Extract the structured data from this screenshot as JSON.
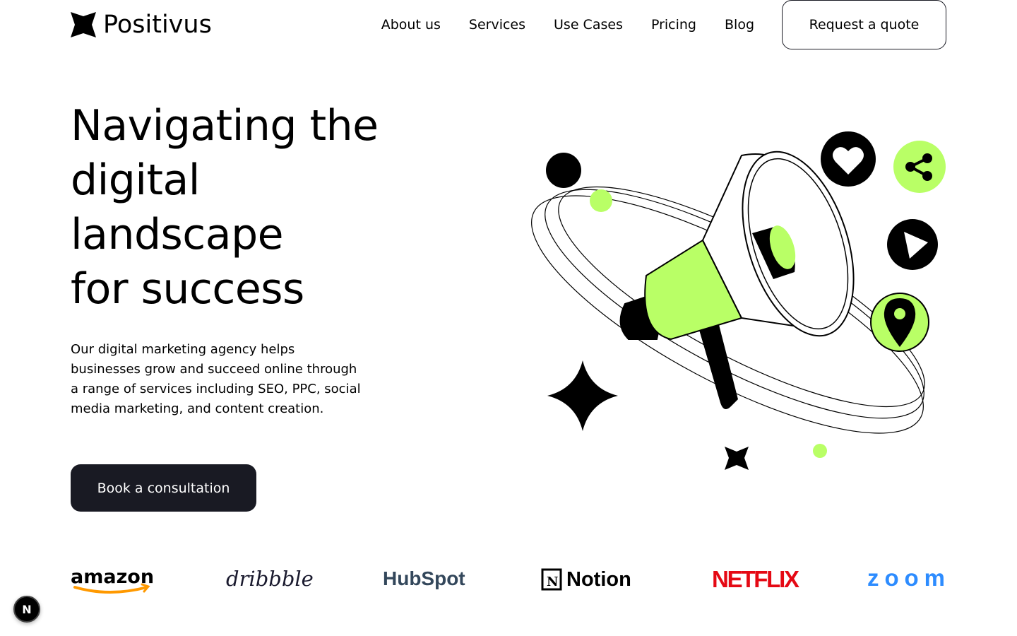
{
  "header": {
    "brand": "Positivus",
    "nav": [
      "About us",
      "Services",
      "Use Cases",
      "Pricing",
      "Blog"
    ],
    "cta": "Request a quote"
  },
  "hero": {
    "title_lines": [
      "Navigating the",
      "digital",
      "landscape",
      "for success"
    ],
    "description": "Our digital marketing agency helps businesses grow and succeed online through a range of services including SEO, PPC, social media marketing, and content creation.",
    "cta": "Book a consultation"
  },
  "logos": [
    "amazon",
    "dribbble",
    "HubSpot",
    "Notion",
    "NETFLIX",
    "zoom"
  ],
  "dev_badge": "N",
  "colors": {
    "accent": "#B9FF66",
    "dark": "#191A23",
    "hubspot": "#FF7A59",
    "netflix": "#E50914",
    "zoom": "#2D8CFF",
    "amazon_smile": "#FF9900"
  },
  "icons": [
    "logo-star-icon",
    "heart-icon",
    "share-icon",
    "play-icon",
    "location-pin-icon",
    "megaphone-icon",
    "sparkle-icon"
  ]
}
